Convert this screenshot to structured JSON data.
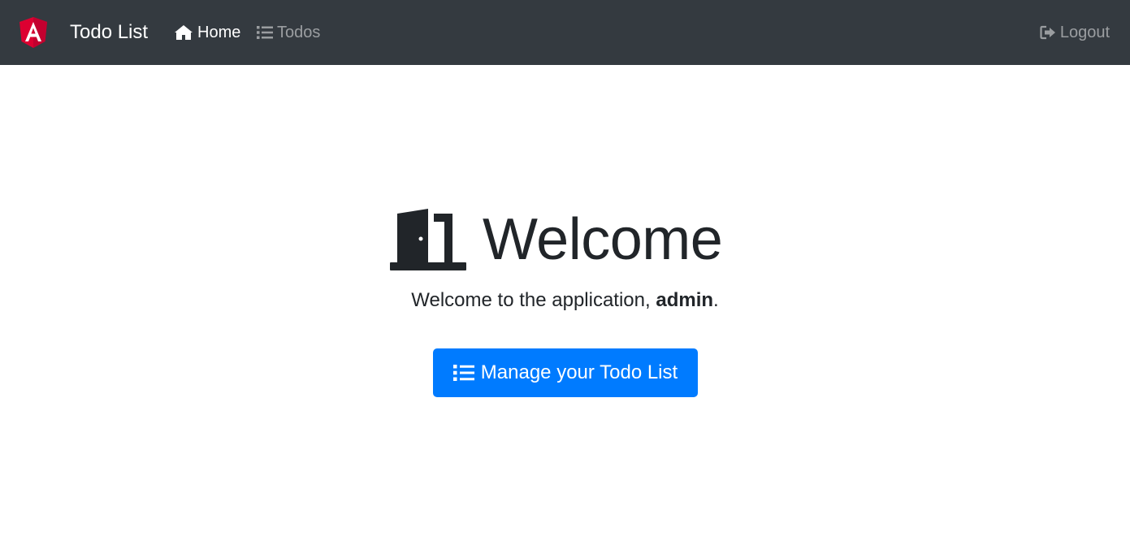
{
  "navbar": {
    "brand_title": "Todo List",
    "brand_logo": "angular-logo-icon",
    "links": [
      {
        "label": "Home",
        "icon": "home-icon",
        "active": true
      },
      {
        "label": "Todos",
        "icon": "list-icon",
        "active": false
      }
    ],
    "logout_label": "Logout",
    "logout_icon": "sign-out-icon",
    "background": "#343a40"
  },
  "hero": {
    "title": "Welcome",
    "icon": "door-open-icon",
    "text_prefix": "Welcome to the application, ",
    "username": "admin",
    "text_suffix": ".",
    "button_label": "Manage your Todo List",
    "button_icon": "list-icon",
    "button_color": "#007bff"
  }
}
